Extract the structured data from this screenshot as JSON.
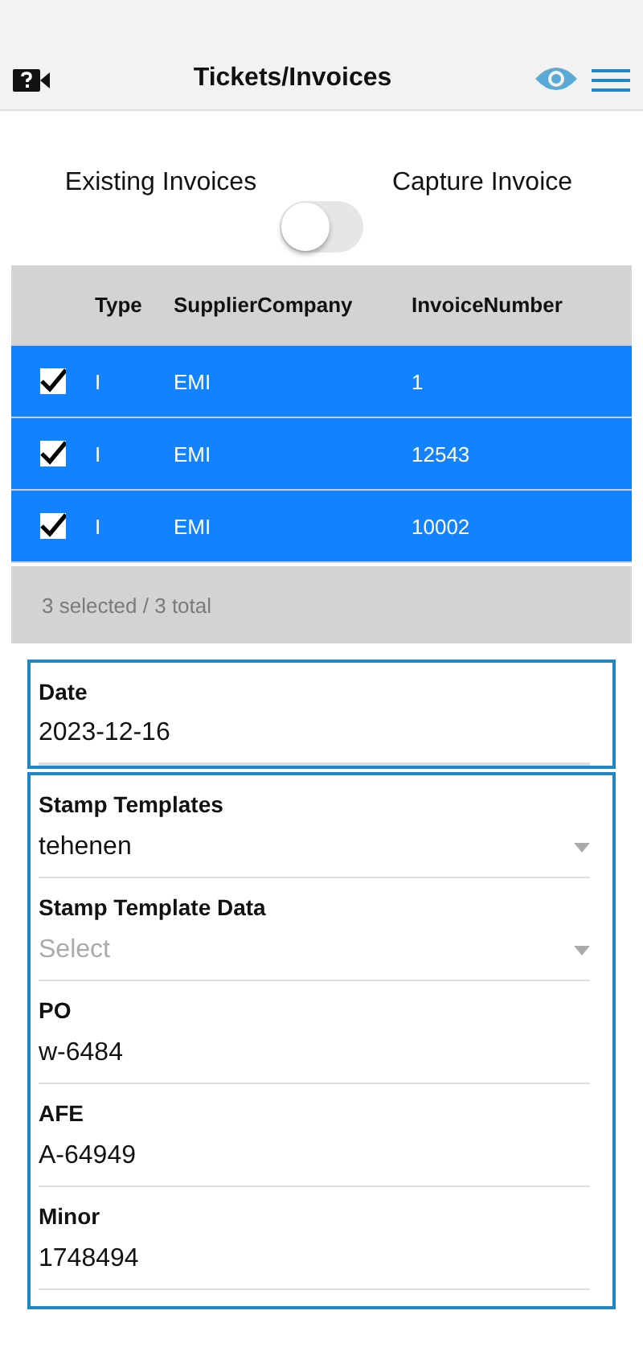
{
  "header": {
    "title": "Tickets/Invoices"
  },
  "mode_toggle": {
    "left_label": "Existing Invoices",
    "right_label": "Capture Invoice",
    "on": false
  },
  "table": {
    "columns": [
      "Type",
      "SupplierCompany",
      "InvoiceNumber"
    ],
    "rows": [
      {
        "checked": true,
        "selected": true,
        "cells": [
          "I",
          "EMI",
          "1"
        ]
      },
      {
        "checked": true,
        "selected": true,
        "cells": [
          "I",
          "EMI",
          "12543"
        ]
      },
      {
        "checked": true,
        "selected": true,
        "cells": [
          "I",
          "EMI",
          "10002"
        ]
      }
    ],
    "footer": "3 selected / 3 total"
  },
  "date_field": {
    "label": "Date",
    "value": "2023-12-16"
  },
  "stamp_fields": [
    {
      "kind": "select",
      "label": "Stamp Templates",
      "value": "tehenen"
    },
    {
      "kind": "select",
      "label": "Stamp Template Data",
      "placeholder": "Select"
    },
    {
      "kind": "input",
      "label": "PO",
      "value": "w-6484"
    },
    {
      "kind": "input",
      "label": "AFE",
      "value": "A-64949"
    },
    {
      "kind": "input",
      "label": "Minor",
      "value": "1748494"
    }
  ]
}
